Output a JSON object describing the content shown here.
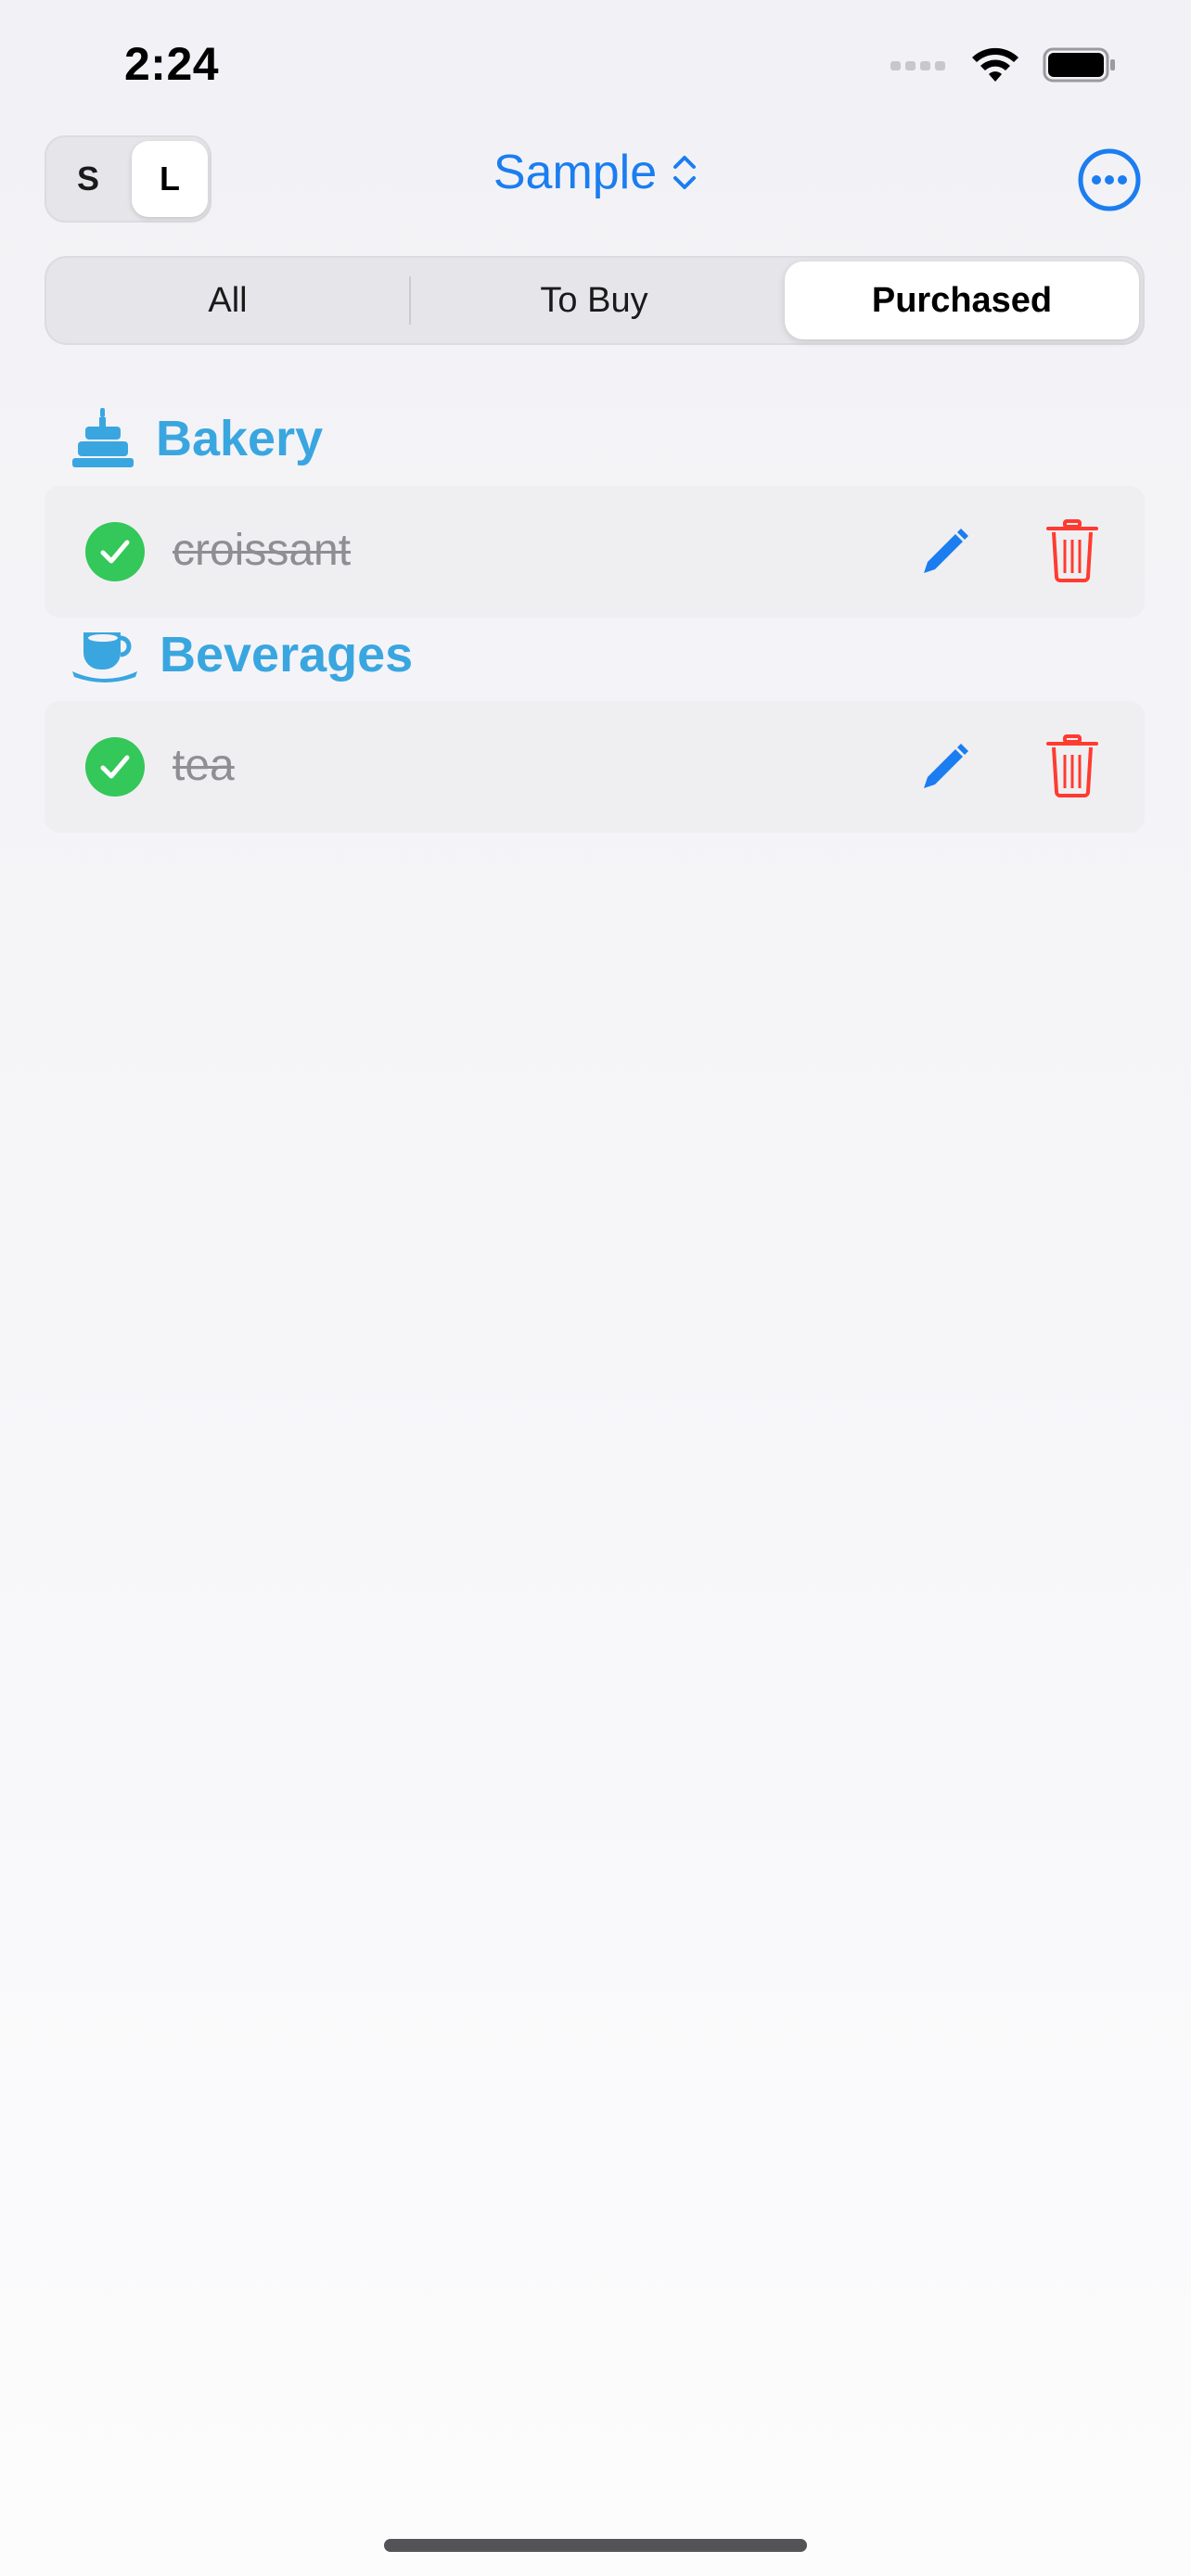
{
  "status_bar": {
    "time": "2:24"
  },
  "header": {
    "size_options": [
      "S",
      "L"
    ],
    "selected_size": "L",
    "list_title": "Sample"
  },
  "filter": {
    "tabs": [
      "All",
      "To Buy",
      "Purchased"
    ],
    "selected": "Purchased"
  },
  "sections": [
    {
      "name": "Bakery",
      "icon": "cake-icon",
      "items": [
        {
          "name": "croissant",
          "purchased": true
        }
      ]
    },
    {
      "name": "Beverages",
      "icon": "cup-icon",
      "items": [
        {
          "name": "tea",
          "purchased": true
        }
      ]
    }
  ],
  "colors": {
    "accent": "#1b7df0",
    "section": "#3aa6e0",
    "check": "#34c759",
    "delete": "#ff3b30"
  }
}
